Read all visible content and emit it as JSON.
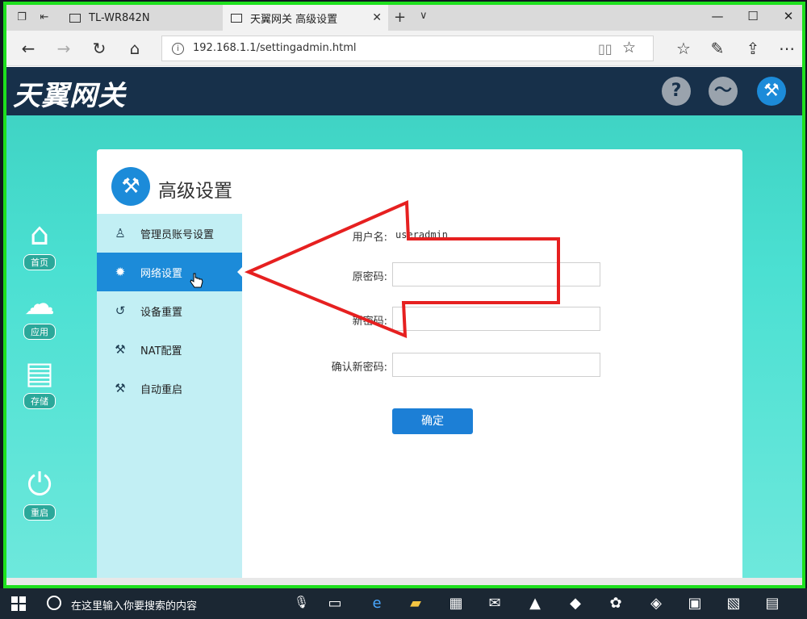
{
  "browser": {
    "tabs": [
      {
        "title": "TL-WR842N",
        "active": false
      },
      {
        "title": "天翼网关 高级设置",
        "active": true
      }
    ],
    "url": "192.168.1.1/settingadmin.html",
    "window_controls": {
      "minimize": "—",
      "maximize": "☐",
      "close": "✕"
    }
  },
  "page": {
    "logo": "天翼网关",
    "header_buttons": [
      "help-icon",
      "network-icon",
      "settings-wrench-icon"
    ]
  },
  "rail": {
    "home": "首页",
    "apps": "应用",
    "storage": "存储",
    "reboot": "重启"
  },
  "panel": {
    "title": "高级设置",
    "menu": [
      {
        "label": "管理员账号设置",
        "icon": "user-icon"
      },
      {
        "label": "网络设置",
        "icon": "gear-icon"
      },
      {
        "label": "设备重置",
        "icon": "reset-icon"
      },
      {
        "label": "NAT配置",
        "icon": "wrench-icon"
      },
      {
        "label": "自动重启",
        "icon": "wrench-icon"
      }
    ],
    "form": {
      "username_label": "用户名:",
      "username_value": "useradmin",
      "old_password_label": "原密码:",
      "new_password_label": "新密码:",
      "confirm_password_label": "确认新密码:",
      "submit_label": "确定"
    }
  },
  "taskbar": {
    "search_placeholder": "在这里输入你要搜索的内容"
  },
  "colors": {
    "accent": "#1c8bd9",
    "header": "#17304a",
    "menu_bg": "#c2eff4",
    "annotation_arrow": "#e62020"
  }
}
